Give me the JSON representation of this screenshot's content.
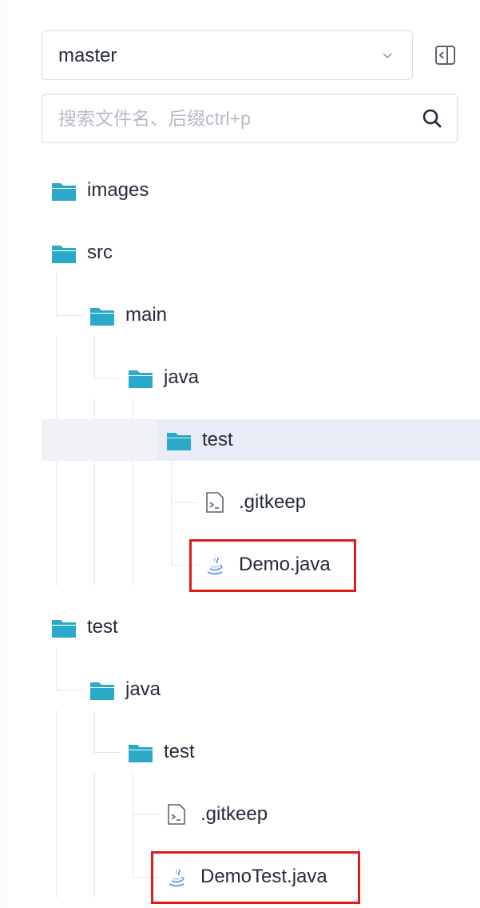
{
  "branch_selector": {
    "value": "master",
    "dropdown_icon": "chevron-down-icon"
  },
  "sidebar_toggle": {
    "icon": "collapse-sidebar-icon"
  },
  "search": {
    "placeholder": "搜索文件名、后缀ctrl+p",
    "value": "",
    "icon": "search-icon"
  },
  "file_tree": {
    "folder_color": "#2aa9c9",
    "java_icon_color": "#5b8cf4",
    "selection_color": "#e9ecf6",
    "highlight_color": "#e01b1b",
    "items": [
      {
        "label": "images",
        "type": "folder",
        "depth": 0
      },
      {
        "label": "src",
        "type": "folder",
        "depth": 0
      },
      {
        "label": "main",
        "type": "folder",
        "depth": 1
      },
      {
        "label": "java",
        "type": "folder",
        "depth": 2
      },
      {
        "label": "test",
        "type": "folder",
        "depth": 3,
        "selected": true
      },
      {
        "label": ".gitkeep",
        "type": "file",
        "depth": 4
      },
      {
        "label": "Demo.java",
        "type": "java-file",
        "depth": 4,
        "highlighted": true
      },
      {
        "label": "test",
        "type": "folder",
        "depth": 0
      },
      {
        "label": "java",
        "type": "folder",
        "depth": 1
      },
      {
        "label": "test",
        "type": "folder",
        "depth": 2
      },
      {
        "label": ".gitkeep",
        "type": "file",
        "depth": 3
      },
      {
        "label": "DemoTest.java",
        "type": "java-file",
        "depth": 3,
        "highlighted": true
      }
    ]
  }
}
